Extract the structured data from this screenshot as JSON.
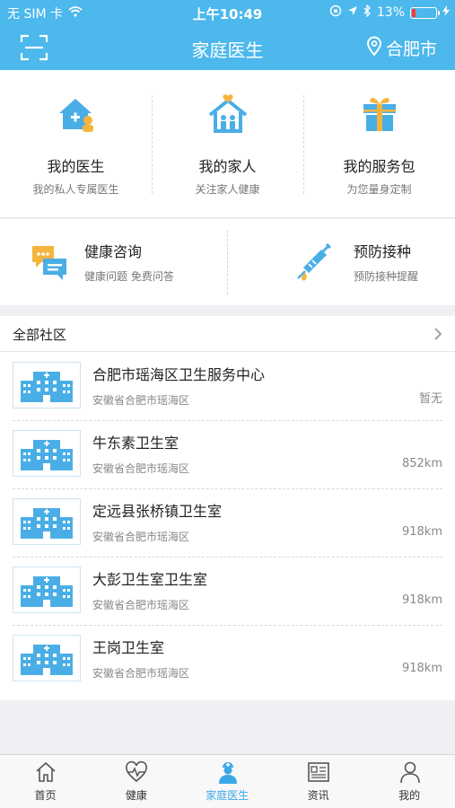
{
  "status_bar": {
    "carrier": "无 SIM 卡",
    "time": "上午10:49",
    "battery": "13%",
    "battery_level": 0.13,
    "icons": [
      "wifi-icon",
      "orientation-lock-icon",
      "location-arrow-icon",
      "bluetooth-icon",
      "battery-icon",
      "charging-icon"
    ]
  },
  "header": {
    "title": "家庭医生",
    "city": "合肥市",
    "icons": [
      "scan-icon",
      "location-pin-icon"
    ]
  },
  "services": [
    {
      "title": "我的医生",
      "subtitle": "我的私人专属医生",
      "icon": "doctor-house-icon"
    },
    {
      "title": "我的家人",
      "subtitle": "关注家人健康",
      "icon": "family-house-icon"
    },
    {
      "title": "我的服务包",
      "subtitle": "为您量身定制",
      "icon": "gift-icon"
    }
  ],
  "services2": [
    {
      "title": "健康咨询",
      "subtitle": "健康问题 免费问答",
      "icon": "chat-bubbles-icon"
    },
    {
      "title": "预防接种",
      "subtitle": "预防接种提醒",
      "icon": "syringe-icon"
    }
  ],
  "community": {
    "title": "全部社区",
    "items": [
      {
        "name": "合肥市瑶海区卫生服务中心",
        "address": "安徽省合肥市瑶海区",
        "distance": "暂无"
      },
      {
        "name": "牛东素卫生室",
        "address": "安徽省合肥市瑶海区",
        "distance": "852km"
      },
      {
        "name": "定远县张桥镇卫生室",
        "address": "安徽省合肥市瑶海区",
        "distance": "918km"
      },
      {
        "name": "大彭卫生室卫生室",
        "address": "安徽省合肥市瑶海区",
        "distance": "918km"
      },
      {
        "name": "王岗卫生室",
        "address": "安徽省合肥市瑶海区",
        "distance": "918km"
      }
    ]
  },
  "tabs": [
    {
      "label": "首页",
      "icon": "home-icon"
    },
    {
      "label": "健康",
      "icon": "heartbeat-icon"
    },
    {
      "label": "家庭医生",
      "icon": "doctor-icon",
      "active": true
    },
    {
      "label": "资讯",
      "icon": "news-icon"
    },
    {
      "label": "我的",
      "icon": "person-icon"
    }
  ],
  "colors": {
    "accent": "#4cb8ec",
    "active_tab": "#3aa7e6",
    "icon_blue": "#4aaee6",
    "icon_orange": "#f5b53d",
    "background": "#efeff4"
  }
}
